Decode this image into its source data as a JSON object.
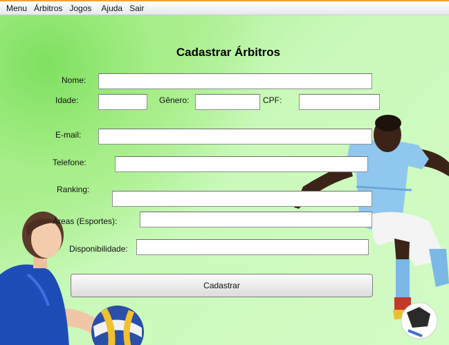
{
  "menu": [
    "Menu",
    "Árbitros",
    "Jogos",
    "Ajuda",
    "Sair"
  ],
  "form": {
    "title": "Cadastrar Árbitros",
    "labels": {
      "nome": "Nome:",
      "idade": "Idade:",
      "genero": "Gênero:",
      "cpf": "CPF:",
      "email": "E-mail:",
      "telefone": "Telefone:",
      "ranking": "Ranking:",
      "areas": "Áreas (Esportes):",
      "disponibilidade": "Disponibilidade:"
    },
    "values": {
      "nome": "",
      "idade": "",
      "genero": "",
      "cpf": "",
      "email": "",
      "telefone": "",
      "ranking": "",
      "areas": "",
      "disponibilidade": ""
    },
    "submit": "Cadastrar"
  },
  "images": {
    "left": "volleyball-player-photo",
    "right": "soccer-player-photo"
  }
}
